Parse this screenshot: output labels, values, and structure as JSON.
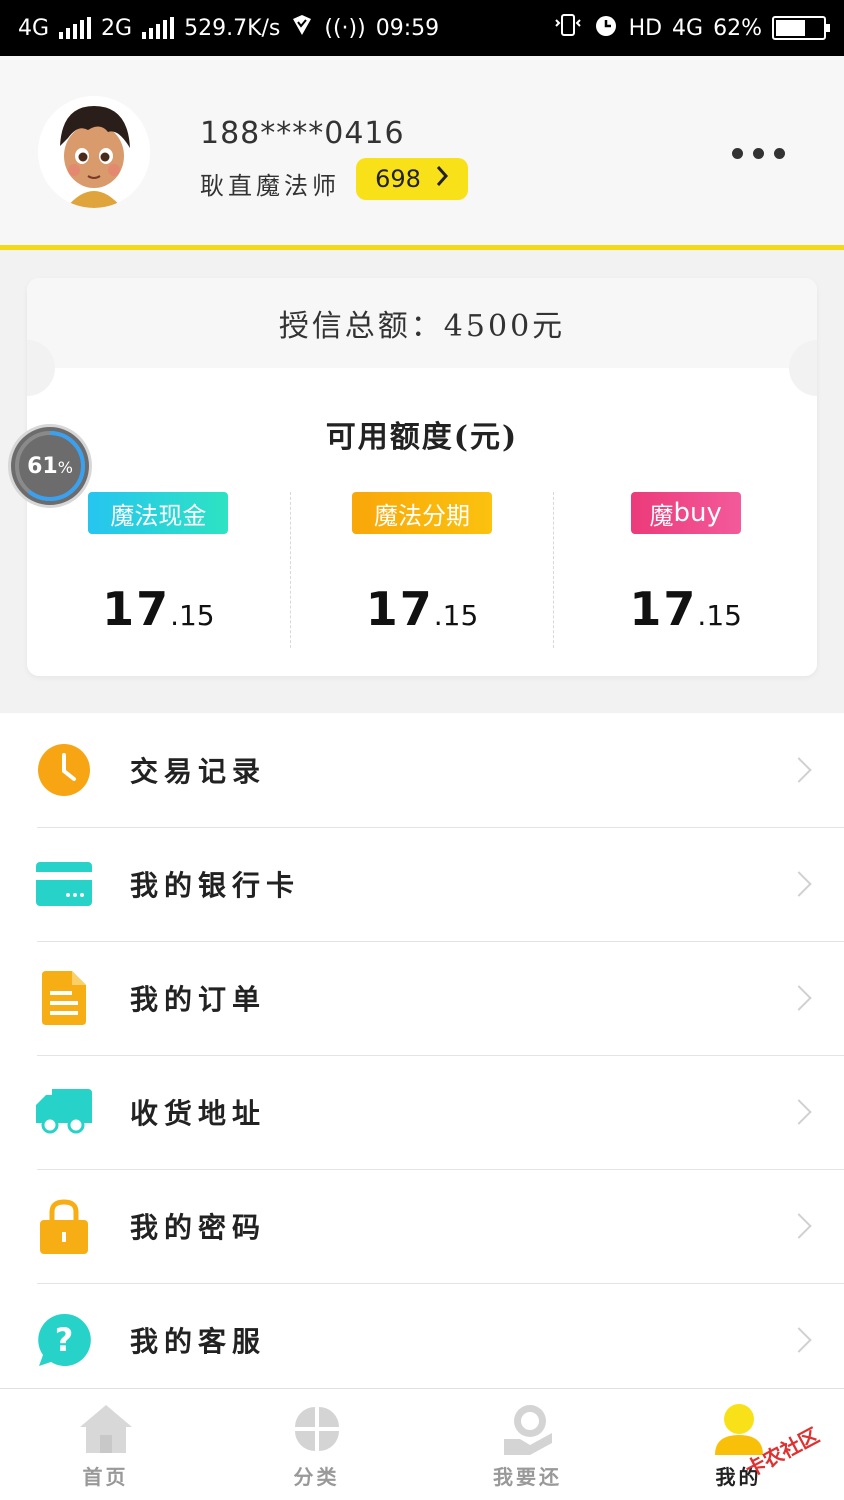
{
  "status_bar": {
    "network1": "4G",
    "network2": "2G",
    "speed": "529.7K/s",
    "time": "09:59",
    "hd": "HD",
    "lte": "4G",
    "battery_percent": "62%",
    "battery_level": 0.62
  },
  "profile": {
    "phone": "188****0416",
    "nickname": "耿直魔法师",
    "score": "698"
  },
  "credit": {
    "total_label": "授信总额：4500元",
    "available_label": "可用额度(元)",
    "progress_percent": "61",
    "progress_unit": "%",
    "progress_value": 0.61,
    "products": [
      {
        "name": "魔法现金",
        "amount_int": "17",
        "amount_dec": ".15"
      },
      {
        "name": "魔法分期",
        "amount_int": "17",
        "amount_dec": ".15"
      },
      {
        "name_prefix": "魔",
        "name_suffix": "buy",
        "amount_int": "17",
        "amount_dec": ".15"
      }
    ]
  },
  "menu": {
    "items": [
      {
        "label": "交易记录",
        "icon": "clock-icon",
        "color": "#f8a514"
      },
      {
        "label": "我的银行卡",
        "icon": "bank-card-icon",
        "color": "#27d3c8"
      },
      {
        "label": "我的订单",
        "icon": "document-icon",
        "color": "#f7ad14"
      },
      {
        "label": "收货地址",
        "icon": "truck-icon",
        "color": "#27d3c8"
      },
      {
        "label": "我的密码",
        "icon": "lock-icon",
        "color": "#f7ad14"
      },
      {
        "label": "我的客服",
        "icon": "help-bubble-icon",
        "color": "#27d3c8"
      }
    ]
  },
  "bottom_nav": {
    "items": [
      {
        "label": "首页",
        "icon": "home-icon"
      },
      {
        "label": "分类",
        "icon": "category-icon"
      },
      {
        "label": "我要还",
        "icon": "repay-icon"
      },
      {
        "label": "我的",
        "icon": "user-icon",
        "active": true
      }
    ]
  },
  "watermark": "卡农社区",
  "colors": {
    "accent": "#f9e11a",
    "teal": "#27d3c8",
    "orange": "#f7ad14"
  }
}
